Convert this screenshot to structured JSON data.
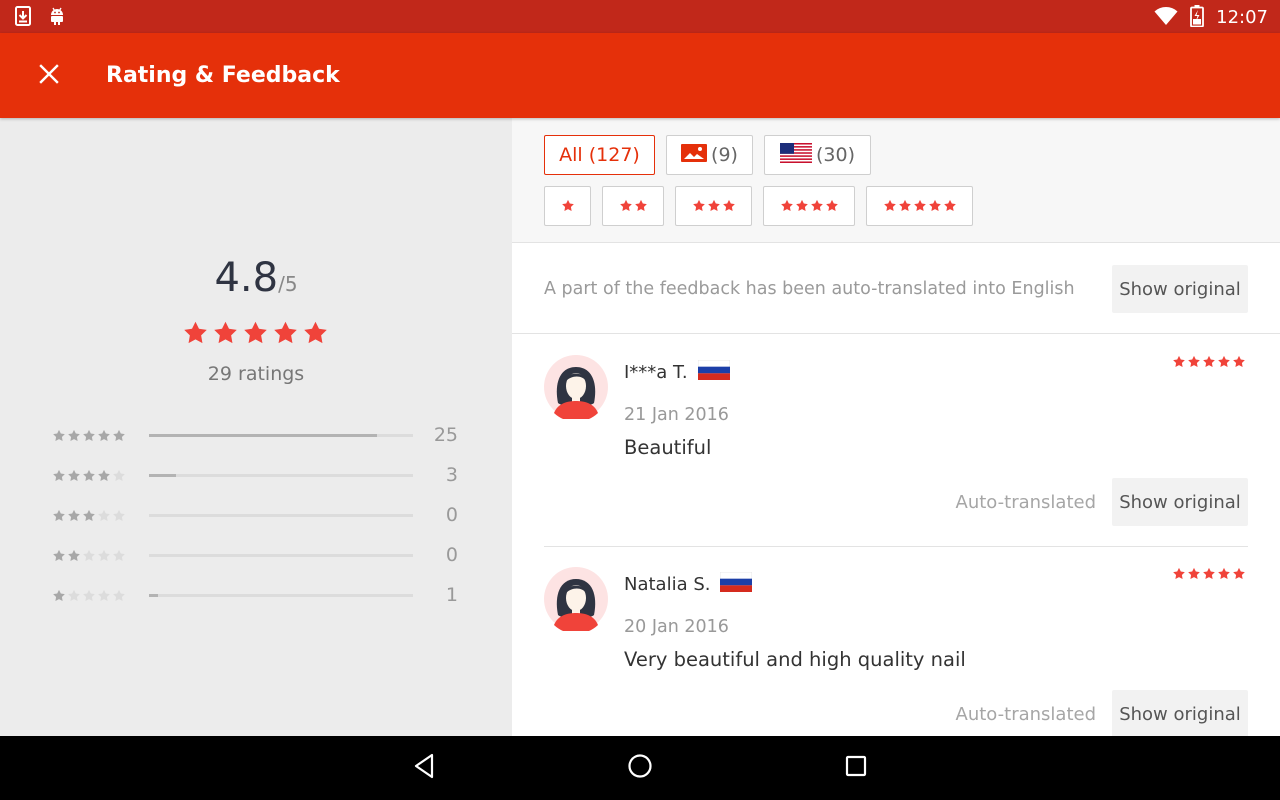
{
  "status_bar": {
    "time": "12:07",
    "icons": [
      "download-icon",
      "android-icon",
      "wifi-icon",
      "battery-icon"
    ]
  },
  "app_bar": {
    "title": "Rating & Feedback",
    "close_icon": "close-icon"
  },
  "summary": {
    "score": "4.8",
    "score_max": "/5",
    "stars": 5,
    "ratings_count": "29 ratings",
    "histogram": [
      {
        "stars": 5,
        "count": "25",
        "fraction": 0.862
      },
      {
        "stars": 4,
        "count": "3",
        "fraction": 0.103
      },
      {
        "stars": 3,
        "count": "0",
        "fraction": 0
      },
      {
        "stars": 2,
        "count": "0",
        "fraction": 0
      },
      {
        "stars": 1,
        "count": "1",
        "fraction": 0.034
      }
    ]
  },
  "filters": {
    "all": "All (127)",
    "photos": "(9)",
    "country": "(30)",
    "star_filters": [
      1,
      2,
      3,
      4,
      5
    ]
  },
  "notice": {
    "text": "A part of the feedback has been auto-translated into English",
    "button": "Show original"
  },
  "reviews": [
    {
      "name": "I***a T.",
      "flag": "russia-flag-icon",
      "rating": 5,
      "date": "21 Jan 2016",
      "text": "Beautiful",
      "auto_label": "Auto-translated",
      "button": "Show original"
    },
    {
      "name": "Natalia S.",
      "flag": "russia-flag-icon",
      "rating": 5,
      "date": "20 Jan 2016",
      "text": "Very beautiful and high quality nail",
      "auto_label": "Auto-translated",
      "button": "Show original"
    }
  ],
  "colors": {
    "accent": "#e5300a",
    "status_bar": "#c1281a",
    "star": "#f0433a",
    "star_gray": "#c8c8c8"
  }
}
